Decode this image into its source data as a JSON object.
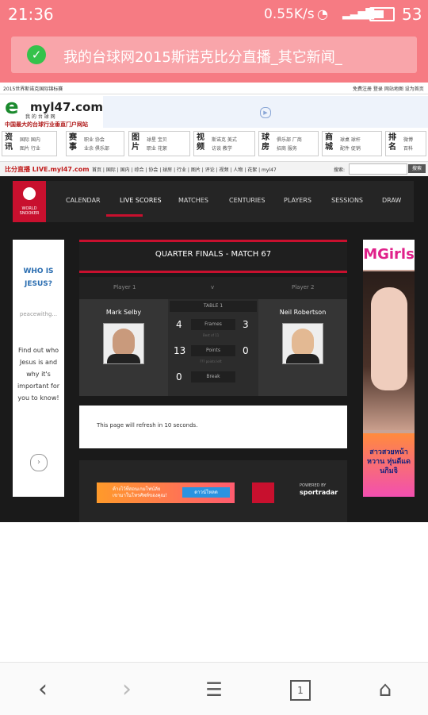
{
  "status_bar": {
    "time": "21:36",
    "network": "0.55K/s",
    "battery": "53"
  },
  "url_bar": {
    "title": "我的台球网2015斯诺克比分直播_其它新闻_"
  },
  "site": {
    "top_left_text": "2015世界斯诺克国际锦标赛",
    "top_right_links": "免费注册 登录 网站地图 设为首页",
    "logo_name": "myl47.com",
    "logo_cn": "我 的 台 球 网",
    "logo_slogan": "中国最大的台球行业垂直门户网站",
    "nav_boxes": [
      {
        "title": "资讯",
        "sub1": "国际 国内",
        "sub2": "图片 行业"
      },
      {
        "title": "赛事",
        "sub1": "职业 协会",
        "sub2": "业余 俱乐部"
      },
      {
        "title": "图片",
        "sub1": "球星 宝贝",
        "sub2": "职业 花絮"
      },
      {
        "title": "视频",
        "sub1": "斯诺克 美式",
        "sub2": "访谈 教学"
      },
      {
        "title": "球房",
        "sub1": "俱乐部 厂商",
        "sub2": "招商 服务"
      },
      {
        "title": "商城",
        "sub1": "球桌 球杆",
        "sub2": "配件 促销"
      },
      {
        "title": "排名",
        "sub1": "微博",
        "sub2": "百科"
      }
    ],
    "live_title": "比分直播 LIVE.myl47.com",
    "live_links": "首页 | 国际 | 国内 | 综合 | 协会 | 球房 | 行业 | 图片 | 评论 | 视频 | 人物 | 花絮 | myl47",
    "search_label": "搜索:",
    "search_button": "搜索"
  },
  "ws_nav": {
    "logo_text": "WORLD SNOOKER",
    "items": [
      "CALENDAR",
      "LIVE SCORES",
      "MATCHES",
      "CENTURIES",
      "PLAYERS",
      "SESSIONS",
      "DRAW"
    ]
  },
  "ad_left": {
    "heading": "WHO IS JESUS?",
    "source": "peacewithg...",
    "body": "Find out who Jesus is and why it's important for you to know!"
  },
  "ad_right": {
    "brand": "MGirls",
    "thai": "สาวสวยหน้าหวาน หุ่นดีแดนกิมจิ"
  },
  "match": {
    "title": "QUARTER FINALS - MATCH 67",
    "player1_label": "Player 1",
    "vs": "v",
    "player2_label": "Player 2",
    "table": "TABLE 1",
    "player1_name": "Mark Selby",
    "player2_name": "Neil Robertson",
    "frames_label": "Frames",
    "frames_p1": "4",
    "frames_p2": "3",
    "best_of": "Best of 11",
    "points_label": "Points",
    "points_p1": "13",
    "points_p2": "0",
    "points_left": "??? points left",
    "break_label": "Break",
    "break_p1": "0"
  },
  "refresh_text": "This page will refresh in 10 seconds.",
  "footer": {
    "ad_text1": "ค้างไว้ที่สอนเกมโฟน์ลัย",
    "ad_text2": "เขามาในโทรศัพท์ของคุณ!",
    "ad_button": "ดาวน์โหลด",
    "powered_by": "POWERED BY",
    "sportradar": "sportradar"
  },
  "bottom_bar": {
    "tab_count": "1"
  },
  "colors": {
    "status_pink": "#f67b83",
    "accent_red": "#c8102e",
    "dark_bg": "#1a1a1a"
  }
}
